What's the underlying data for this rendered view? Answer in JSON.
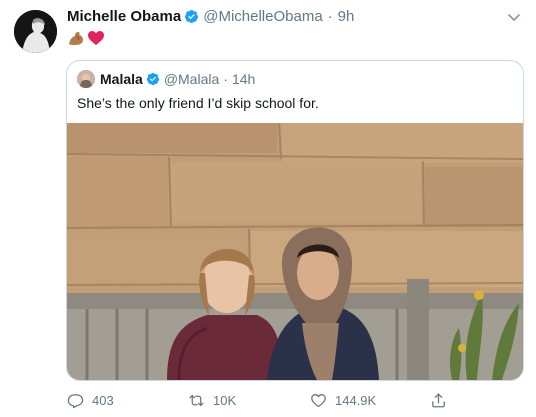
{
  "tweet": {
    "author_name": "Michelle Obama",
    "author_handle": "@MichelleObama",
    "separator": "·",
    "time": "9h",
    "text": "💪🏽❤️"
  },
  "quoted_tweet": {
    "author_name": "Malala",
    "author_handle": "@Malala",
    "separator": "·",
    "time": "14h",
    "text": "She’s the only friend I’d skip school for."
  },
  "actions": {
    "reply_count": "403",
    "retweet_count": "10K",
    "like_count": "144.9K"
  },
  "icons": {
    "verified": "verified-badge-icon",
    "more": "chevron-down-icon",
    "reply": "reply-icon",
    "retweet": "retweet-icon",
    "like": "heart-icon",
    "share": "share-icon"
  },
  "colors": {
    "verified": "#1da1f2",
    "secondary_text": "#657786",
    "border": "#ccd6dd",
    "heart": "#e0245e"
  }
}
